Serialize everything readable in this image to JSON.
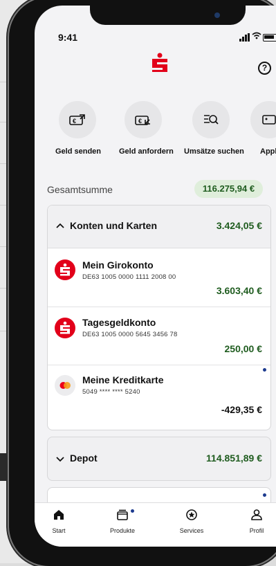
{
  "status_bar": {
    "time": "9:41"
  },
  "quick_actions": [
    {
      "label": "Geld senden",
      "icon": "money-send-icon"
    },
    {
      "label": "Geld anfordern",
      "icon": "money-request-icon"
    },
    {
      "label": "Umsätze suchen",
      "icon": "search-transactions-icon"
    },
    {
      "label": "Appl",
      "icon": "apple-pay-card-icon"
    }
  ],
  "total": {
    "label": "Gesamtsumme",
    "amount": "116.275,94 €"
  },
  "accounts_section": {
    "title": "Konten und Karten",
    "amount": "3.424,05 €",
    "accounts": [
      {
        "name": "Mein Girokonto",
        "iban": "DE63 1005 0000 1111 2008 00",
        "balance": "3.603,40 €"
      },
      {
        "name": "Tagesgeldkonto",
        "iban": "DE63 1005 0000 5645 3456 78",
        "balance": "250,00 €"
      },
      {
        "name": "Meine Kreditkarte",
        "iban": "5049 **** **** 5240",
        "balance": "-429,35 €"
      }
    ]
  },
  "depot": {
    "title": "Depot",
    "amount": "114.851,89 €"
  },
  "bottom_nav": [
    {
      "label": "Start",
      "icon": "home-icon"
    },
    {
      "label": "Produkte",
      "icon": "products-icon"
    },
    {
      "label": "Services",
      "icon": "services-icon"
    },
    {
      "label": "Profil",
      "icon": "profile-icon"
    }
  ],
  "colors": {
    "brand_red": "#e2001a",
    "positive_green": "#1f5c1f",
    "notification_dot": "#1d3b8f"
  }
}
